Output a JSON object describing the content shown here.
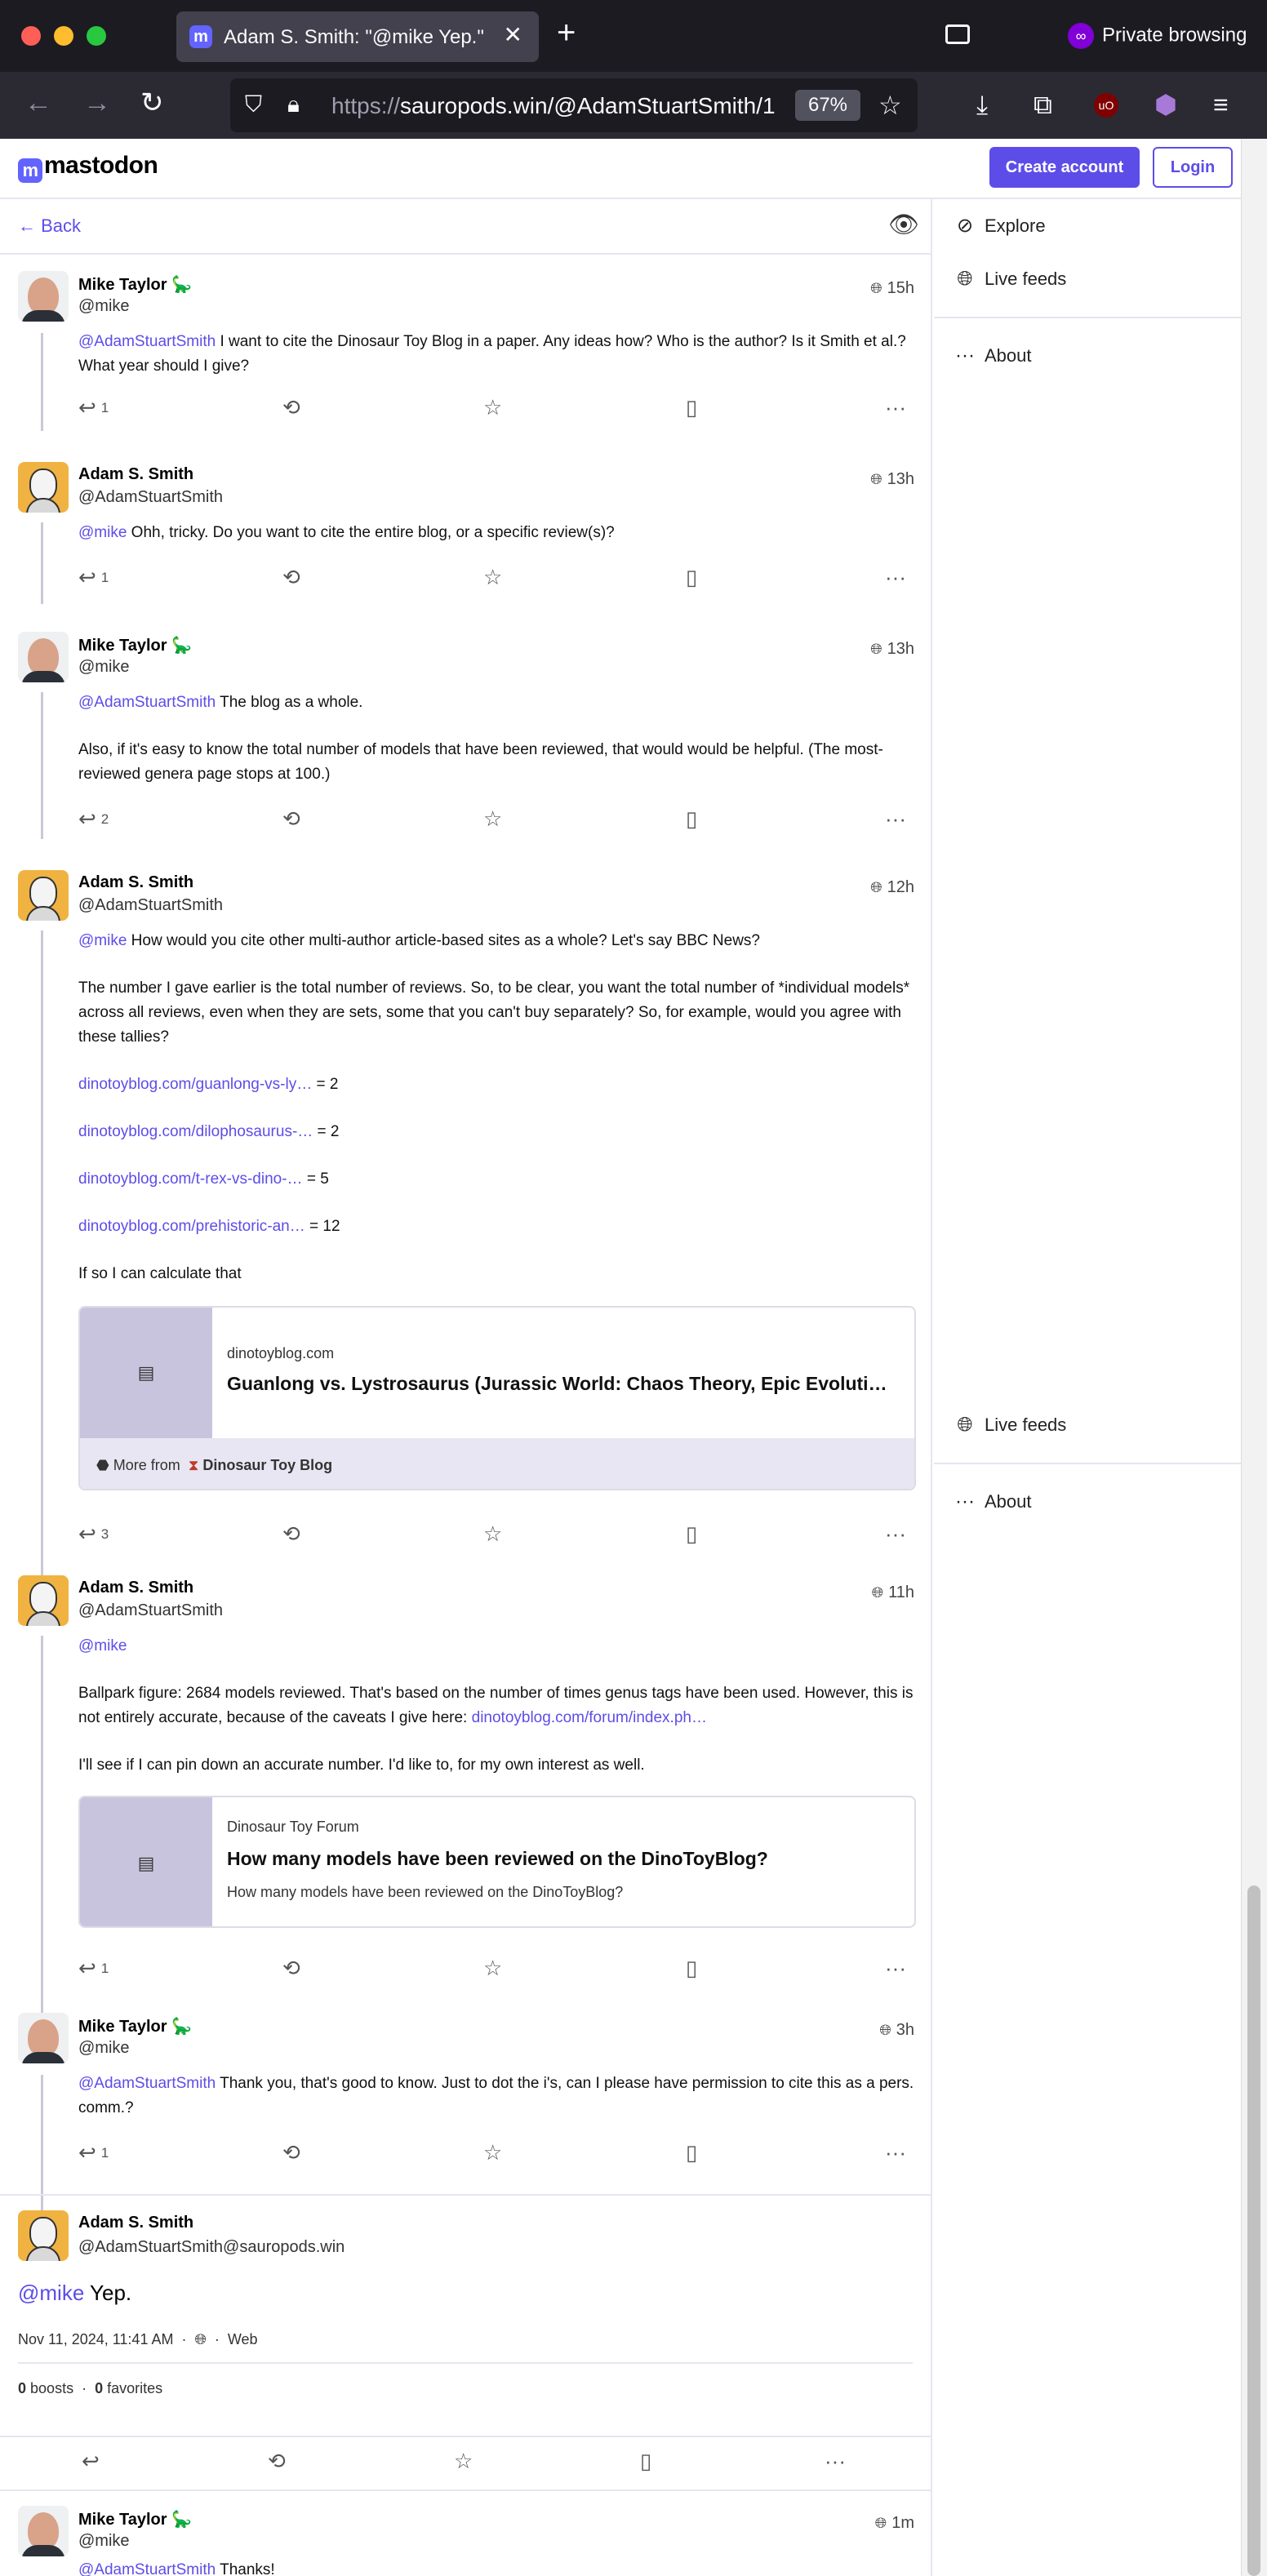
{
  "browser": {
    "tab_title": "Adam S. Smith: \"@mike Yep.\" - S",
    "private_label": "Private browsing",
    "url_prefix": "https://",
    "url_main": "sauropods.win/@AdamStuartSmith/1",
    "zoom": "67%",
    "colors": {
      "tab_bg": "#42414d",
      "chrome_bg": "#1c1b22",
      "accent": "#6364ff"
    }
  },
  "header": {
    "logo": "mastodon",
    "create_account": "Create account",
    "login": "Login"
  },
  "column": {
    "back_label": "Back"
  },
  "sidebar": {
    "top": [
      {
        "label": "Explore",
        "icon": "compass-icon"
      },
      {
        "label": "Live feeds",
        "icon": "globe-icon"
      },
      {
        "label": "About",
        "icon": "ellipsis-icon"
      }
    ],
    "bottom": [
      {
        "label": "Live feeds",
        "icon": "globe-icon"
      },
      {
        "label": "About",
        "icon": "ellipsis-icon"
      }
    ]
  },
  "posts": [
    {
      "name": "Mike Taylor 🦕",
      "handle": "@mike",
      "time": "15h",
      "mention": "@AdamStuartSmith",
      "text": " I want to cite the Dinosaur Toy Blog in a paper. Any ideas how? Who is the author? Is it Smith et al.? What year should I give?",
      "replies": "1"
    },
    {
      "name": "Adam S. Smith",
      "handle": "@AdamStuartSmith",
      "time": "13h",
      "mention": "@mike",
      "text": " Ohh, tricky. Do you want to cite the entire blog, or a specific review(s)?",
      "replies": "1"
    },
    {
      "name": "Mike Taylor 🦕",
      "handle": "@mike",
      "time": "13h",
      "mention": "@AdamStuartSmith",
      "text": " The blog as a whole.",
      "text2": "Also, if it's easy to know the total number of models that have been reviewed, that would would be helpful. (The most-reviewed genera page stops at 100.)",
      "replies": "2"
    },
    {
      "name": "Adam S. Smith",
      "handle": "@AdamStuartSmith",
      "time": "12h",
      "mention": "@mike",
      "text": " How would you cite other multi-author article-based sites as a whole? Let's say BBC News?",
      "text2": "The number I gave earlier is the total number of reviews. So, to be clear, you want the total number of *individual models* across all reviews, even when they are sets, some that you can't buy separately? So, for example, would you agree with these tallies?",
      "links": [
        {
          "href": "dinotoyblog.com/guanlong-vs-ly…",
          "tail": " = 2"
        },
        {
          "href": "dinotoyblog.com/dilophosaurus-…",
          "tail": " = 2"
        },
        {
          "href": "dinotoyblog.com/t-rex-vs-dino-…",
          "tail": " = 5"
        },
        {
          "href": "dinotoyblog.com/prehistoric-an…",
          "tail": " = 12"
        }
      ],
      "text3": "If so I can calculate that",
      "card": {
        "source": "dinotoyblog.com",
        "title": "Guanlong vs. Lystrosaurus (Jurassic World: Chaos Theory, Epic Evoluti…",
        "more_from": "More from",
        "author": "Dinosaur Toy Blog"
      },
      "replies": "3"
    },
    {
      "name": "Adam S. Smith",
      "handle": "@AdamStuartSmith",
      "time": "11h",
      "mention": "@mike",
      "text2a": "Ballpark figure: 2684 models reviewed. That's based on the number of times genus tags have been used. However, this is not entirely accurate, because of the caveats I give here: ",
      "text2link": "dinotoyblog.com/forum/index.ph…",
      "text3": "I'll see if I can pin down an accurate number. I'd like to, for my own interest as well.",
      "card": {
        "source": "Dinosaur Toy Forum",
        "title": "How many models have been reviewed on the DinoToyBlog?",
        "desc": "How many models have been reviewed on the DinoToyBlog?"
      },
      "replies": "1"
    },
    {
      "name": "Mike Taylor 🦕",
      "handle": "@mike",
      "time": "3h",
      "mention": "@AdamStuartSmith",
      "text": " Thank you, that's good to know. Just to dot the i's, can I please have permission to cite this as a pers. comm.?",
      "replies": "1"
    }
  ],
  "focused": {
    "name": "Adam S. Smith",
    "handle": "@AdamStuartSmith@sauropods.win",
    "mention": "@mike",
    "text": " Yep.",
    "date": "Nov 11, 2024, 11:41 AM",
    "app": "Web",
    "boosts_count": "0",
    "boosts_label": "boosts",
    "favs_count": "0",
    "favs_label": "favorites"
  },
  "last": {
    "name": "Mike Taylor 🦕",
    "handle": "@mike",
    "time": "1m",
    "mention": "@AdamStuartSmith",
    "text": " Thanks!"
  }
}
